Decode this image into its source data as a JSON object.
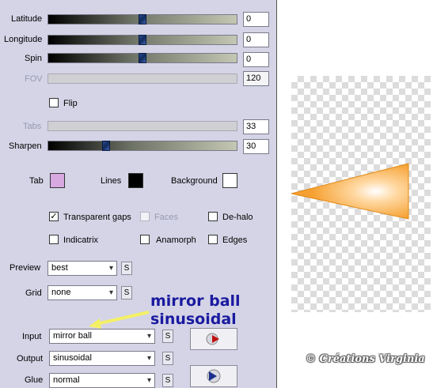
{
  "sliders": [
    {
      "label": "Latitude",
      "value": "0",
      "level": 0.5
    },
    {
      "label": "Longitude",
      "value": "0",
      "level": 0.5
    },
    {
      "label": "Spin",
      "value": "0",
      "level": 0.5
    },
    {
      "label": "FOV",
      "value": "120",
      "disabled": true
    },
    {
      "label": "Tabs",
      "value": "33",
      "disabled": true
    },
    {
      "label": "Sharpen",
      "value": "30",
      "level": 0.3
    }
  ],
  "flip": {
    "label": "Flip",
    "checked": false
  },
  "colors": {
    "tab": {
      "label": "Tab",
      "color": "#d8a8e0"
    },
    "lines": {
      "label": "Lines",
      "color": "#000000"
    },
    "background": {
      "label": "Background",
      "color": "#ffffff"
    }
  },
  "options": {
    "transparent_gaps": {
      "label": "Transparent gaps",
      "checked": true
    },
    "faces": {
      "label": "Faces",
      "checked": false,
      "disabled": true
    },
    "de_halo": {
      "label": "De-halo",
      "checked": false
    },
    "indicatrix": {
      "label": "Indicatrix",
      "checked": false
    },
    "anamorph": {
      "label": "Anamorph",
      "checked": false
    },
    "edges": {
      "label": "Edges",
      "checked": false
    }
  },
  "preview": {
    "label": "Preview",
    "value": "best"
  },
  "grid": {
    "label": "Grid",
    "value": "none"
  },
  "input": {
    "label": "Input",
    "value": "mirror ball"
  },
  "output": {
    "label": "Output",
    "value": "sinusoidal"
  },
  "glue": {
    "label": "Glue",
    "value": "normal"
  },
  "s_button": "S",
  "annotation": {
    "line1": "mirror ball",
    "line2": "sinusoidal",
    "color": "#1a1aa0"
  },
  "watermark": "© Créations Virginia",
  "preview_shape_color": "#f5a030"
}
